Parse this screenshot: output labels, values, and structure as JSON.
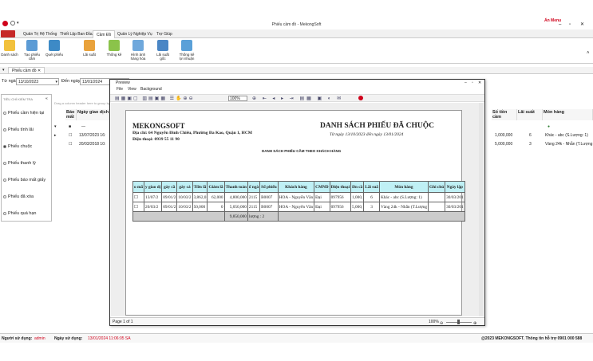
{
  "app": {
    "title": "Phiếu cầm đồ - MekongSoft",
    "brand_menu": "Ẩn Menu"
  },
  "ribbon_tabs": [
    "Quản Trị Hệ Thống",
    "Thiết Lập Ban Đầu",
    "Cầm Đồ",
    "Quản Lý Nghiệp Vụ",
    "Trợ Giúp"
  ],
  "ribbon_active": "Cầm Đồ",
  "ribbon_buttons": [
    "Danh sách",
    "Tạo phiếu cầm",
    "Quét phiếu",
    "Lãi suất",
    "Thống kê",
    "Hình ảnh hàng hóa",
    "Lãi suất gốc",
    "Thống kê lợi nhuận"
  ],
  "doc_tab": "Phiếu cầm đồ",
  "filter": {
    "from_label": "Từ ngày",
    "from_value": "13/10/2023",
    "to_label": "Đến ngày",
    "to_value": "13/01/2024"
  },
  "left_panel": {
    "header": "TIÊU CHÍ KIẾM TRA",
    "items": [
      "Phiếu cầm hiện tại",
      "Phiếu tính lãi",
      "Phiếu chuộc",
      "Phiếu thanh lý",
      "Phiếu báo mất giấy",
      "Phiếu đã xóa",
      "Phiếu quá hạn"
    ],
    "selected": "Phiếu chuộc"
  },
  "grid": {
    "group_hint": "Drag a column header here to group by that column",
    "columns_left": [
      "Báo mất",
      "Ngày giao dịch"
    ],
    "columns_right": [
      "Số tiền cầm",
      "Lãi suất",
      "Món hàng"
    ],
    "filter_symbol": "—",
    "rows": [
      {
        "date": "13/07/2023 16:",
        "amount": "1,000,000",
        "rate": "6",
        "item": "Khác - abc (S.Lượng: 1)"
      },
      {
        "date": "20/03/2018 10:",
        "amount": "5,000,000",
        "rate": "3",
        "item": "Vàng 24k - Nhẫn (T.Lượng"
      }
    ]
  },
  "preview": {
    "title": "Preview",
    "menu": [
      "File",
      "View",
      "Background"
    ],
    "zoom": "100%",
    "page_info": "Page 1 of 1",
    "bottom_zoom": "100%",
    "report": {
      "company": "MEKONGSOFT",
      "address": "Địa chỉ: 64 Nguyễn Đình Chiểu, Phường Đa Kao, Quận 1, HCM",
      "phone": "Điện thoại: 0939 55 11 90",
      "title": "DANH SÁCH PHIẾU ĐÃ CHUỘC",
      "range": "Từ ngày 13/10/2023 đến ngày 13/01/2024",
      "subtitle": "DANH SÁCH PHIẾU CẦM THEO KHÁCH HÀNG",
      "columns": [
        "o mấ",
        "y giao dị",
        "gày cầ",
        "gày cả",
        "Tiền lã",
        "Giảm lã",
        "Thanh toán",
        "ố ngà",
        "Số phiếu",
        "Khách hàng",
        "CMND",
        "Điện thoại",
        "iền cầ",
        "Lãi suấ",
        "Món hàng",
        "Ghi chú",
        "Ngày lập"
      ],
      "rows": [
        [
          "",
          "13/07/2",
          "09/01/2",
          "10/03/2",
          "3,862,0",
          "62,000",
          "4,800,000",
          "2115",
          "B0007",
          "HOA - Nguyễn Văn",
          "Đại",
          "097956",
          "1,000,",
          "6",
          "Khác - abc (S.Lượng: 1)",
          "",
          "30/03/201"
        ],
        [
          "",
          "20/03/2",
          "09/01/2",
          "10/03/2",
          "50,000",
          "0",
          "5,050,000",
          "2115",
          "B0007",
          "HOA - Nguyễn Văn",
          "Đại",
          "097956",
          "5,000,",
          "3",
          "Vàng 24k - Nhẫn (T.Lượng",
          "",
          "30/03/201"
        ]
      ],
      "total": "9,850,000",
      "total_count": "lượng : 2"
    }
  },
  "status": {
    "user_label": "Người sử dụng:",
    "user": "admin",
    "date_label": "Ngày sử dụng:",
    "date": "13/01/2024 11:06:05 SA",
    "copyright": "@2023 MEKONGSOFT. Thông tin hỗ trợ 0901 000 588"
  },
  "colors": {
    "accent_red": "#d0021b",
    "header_cyan": "#bff0f5"
  }
}
